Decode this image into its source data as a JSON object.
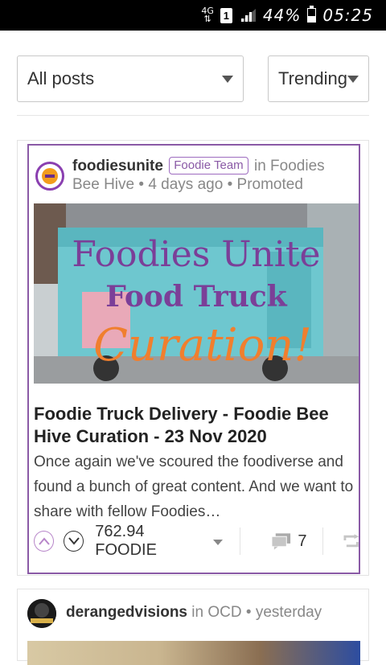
{
  "status_bar": {
    "network": "4G",
    "sim": "1",
    "battery": "44%",
    "time": "05:25"
  },
  "filters": {
    "posts_select": "All posts",
    "sort_select": "Trending"
  },
  "post": {
    "author": "foodiesunite",
    "badge": "Foodie Team",
    "in_word": "in",
    "community": "Foodies Bee Hive",
    "age": "4 days ago",
    "promoted": "Promoted",
    "image_text_1": "Foodies Unite",
    "image_text_2": "Food Truck",
    "image_text_3": "Curation!",
    "title": "Foodie Truck Delivery - Foodie Bee Hive Curation - 23 Nov 2020",
    "excerpt": "Once again we've scoured the foodiverse and found a bunch of great content. And we want to share with fellow Foodies…",
    "payout": "762.94 FOODIE",
    "comments": "7",
    "colors": {
      "accent": "#8a5aa6",
      "title_purple": "#7b3f98",
      "curation_orange": "#f07f2e"
    }
  },
  "post2": {
    "author": "derangedvisions",
    "in_word": "in",
    "community": "OCD",
    "age": "yesterday"
  }
}
